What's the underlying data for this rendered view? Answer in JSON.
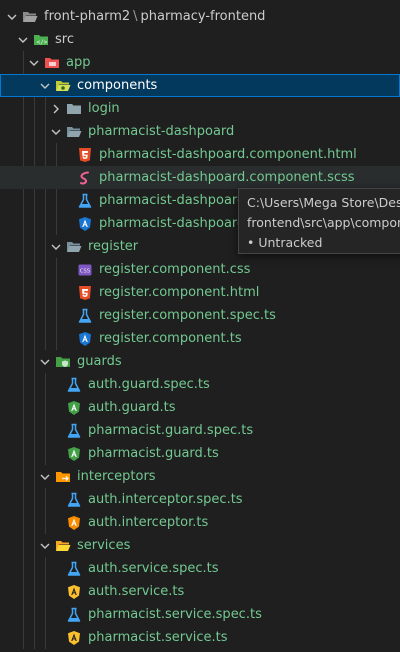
{
  "explorer": {
    "root": "front-pharm2",
    "root_separator": "\\",
    "root_sub": "pharmacy-frontend",
    "items": [
      {
        "label": "src",
        "icon": "src-folder-icon",
        "type": "folder",
        "expanded": true,
        "depth": 1,
        "color": "#cccccc"
      },
      {
        "label": "app",
        "icon": "app-folder-icon",
        "type": "folder",
        "expanded": true,
        "depth": 2,
        "color": "#73c991"
      },
      {
        "label": "components",
        "icon": "components-folder-icon",
        "type": "folder",
        "expanded": true,
        "depth": 3,
        "color": "#ffffff",
        "selected": true
      },
      {
        "label": "login",
        "icon": "folder-icon",
        "type": "folder",
        "expanded": false,
        "depth": 4,
        "color": "#73c991"
      },
      {
        "label": "pharmacist-dashpoard",
        "icon": "folder-open-icon",
        "type": "folder",
        "expanded": true,
        "depth": 4,
        "color": "#73c991"
      },
      {
        "label": "pharmacist-dashpoard.component.html",
        "icon": "html-file-icon",
        "type": "file",
        "depth": 5,
        "color": "#73c991"
      },
      {
        "label": "pharmacist-dashpoard.component.scss",
        "icon": "scss-file-icon",
        "type": "file",
        "depth": 5,
        "color": "#73c991",
        "hovered": true
      },
      {
        "label": "pharmacist-dashpoard.co",
        "icon": "spec-file-icon",
        "type": "file",
        "depth": 5,
        "color": "#73c991"
      },
      {
        "label": "pharmacist-dashpoard.co",
        "icon": "angular-component-icon",
        "type": "file",
        "depth": 5,
        "color": "#73c991"
      },
      {
        "label": "register",
        "icon": "folder-open-icon",
        "type": "folder",
        "expanded": true,
        "depth": 4,
        "color": "#73c991"
      },
      {
        "label": "register.component.css",
        "icon": "css-file-icon",
        "type": "file",
        "depth": 5,
        "color": "#73c991"
      },
      {
        "label": "register.component.html",
        "icon": "html-file-icon",
        "type": "file",
        "depth": 5,
        "color": "#73c991"
      },
      {
        "label": "register.component.spec.ts",
        "icon": "spec-file-icon",
        "type": "file",
        "depth": 5,
        "color": "#73c991"
      },
      {
        "label": "register.component.ts",
        "icon": "angular-component-icon",
        "type": "file",
        "depth": 5,
        "color": "#73c991"
      },
      {
        "label": "guards",
        "icon": "guards-folder-icon",
        "type": "folder",
        "expanded": true,
        "depth": 3,
        "color": "#73c991"
      },
      {
        "label": "auth.guard.spec.ts",
        "icon": "spec-file-icon",
        "type": "file",
        "depth": 4,
        "color": "#73c991"
      },
      {
        "label": "auth.guard.ts",
        "icon": "angular-guard-icon",
        "type": "file",
        "depth": 4,
        "color": "#73c991"
      },
      {
        "label": "pharmacist.guard.spec.ts",
        "icon": "spec-file-icon",
        "type": "file",
        "depth": 4,
        "color": "#73c991"
      },
      {
        "label": "pharmacist.guard.ts",
        "icon": "angular-guard-icon",
        "type": "file",
        "depth": 4,
        "color": "#73c991"
      },
      {
        "label": "interceptors",
        "icon": "interceptors-folder-icon",
        "type": "folder",
        "expanded": true,
        "depth": 3,
        "color": "#73c991"
      },
      {
        "label": "auth.interceptor.spec.ts",
        "icon": "spec-file-icon",
        "type": "file",
        "depth": 4,
        "color": "#73c991"
      },
      {
        "label": "auth.interceptor.ts",
        "icon": "angular-interceptor-icon",
        "type": "file",
        "depth": 4,
        "color": "#73c991"
      },
      {
        "label": "services",
        "icon": "services-folder-icon",
        "type": "folder",
        "expanded": true,
        "depth": 3,
        "color": "#73c991"
      },
      {
        "label": "auth.service.spec.ts",
        "icon": "spec-file-icon",
        "type": "file",
        "depth": 4,
        "color": "#73c991"
      },
      {
        "label": "auth.service.ts",
        "icon": "angular-service-icon",
        "type": "file",
        "depth": 4,
        "color": "#73c991"
      },
      {
        "label": "pharmacist.service.spec.ts",
        "icon": "spec-file-icon",
        "type": "file",
        "depth": 4,
        "color": "#73c991"
      },
      {
        "label": "pharmacist.service.ts",
        "icon": "angular-service-icon",
        "type": "file",
        "depth": 4,
        "color": "#73c991"
      }
    ]
  },
  "tooltip": {
    "line1": "C:\\Users\\Mega Store\\Desktop",
    "line2": "frontend\\src\\app\\componen",
    "line3": "• Untracked"
  }
}
